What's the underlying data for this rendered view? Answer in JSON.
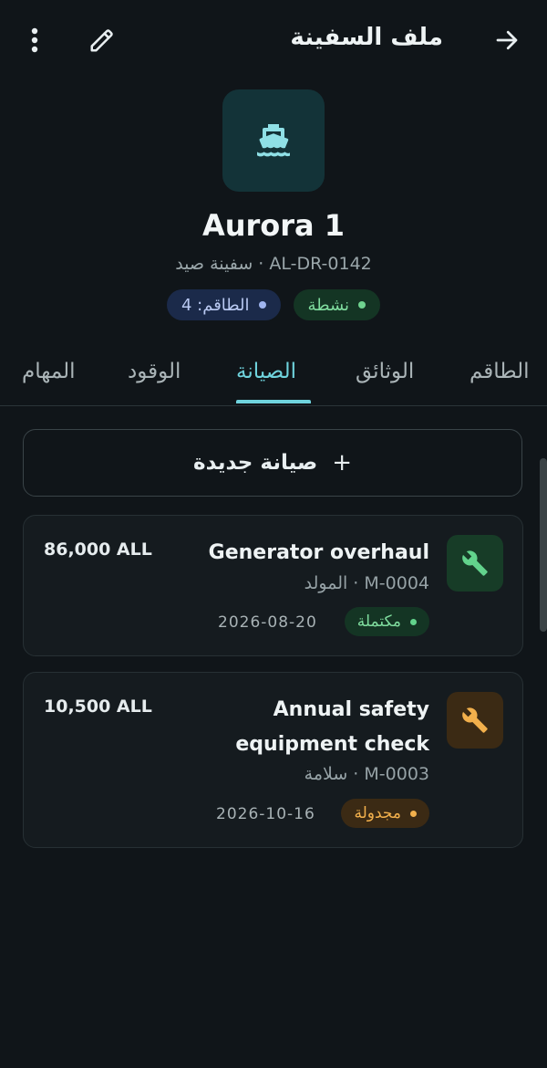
{
  "header": {
    "title": "ملف السفينة"
  },
  "vessel": {
    "name": "Aurora 1",
    "subtitle": "AL-DR-0142 · سفينة صيد",
    "status_chip": "نشطة",
    "crew_chip": "الطاقم: 4"
  },
  "tabs": [
    {
      "label": "الطاقم",
      "active": false
    },
    {
      "label": "الوثائق",
      "active": false
    },
    {
      "label": "الصيانة",
      "active": true
    },
    {
      "label": "الوقود",
      "active": false
    },
    {
      "label": "المهام",
      "active": false
    }
  ],
  "new_button": {
    "label": "صيانة جديدة",
    "icon": "+"
  },
  "maintenance": [
    {
      "title_lines": [
        "Generator overhaul"
      ],
      "meta": "M-0004 · المولد",
      "status": "مكتملة",
      "date": "2026-08-20",
      "cost": "86,000 ALL",
      "icon": "wrench-icon",
      "accent": "#62d38c"
    },
    {
      "title_lines": [
        "Annual safety",
        "equipment check"
      ],
      "meta": "M-0003 · سلامة",
      "status": "مجدولة",
      "date": "2026-10-16",
      "cost": "10,500 ALL",
      "icon": "wrench-icon",
      "accent": "#f2b04c"
    }
  ],
  "colors": {
    "accent": "#6fd3dd",
    "background": "#101519",
    "completed": "#62d38c",
    "scheduled": "#f2b04c"
  }
}
